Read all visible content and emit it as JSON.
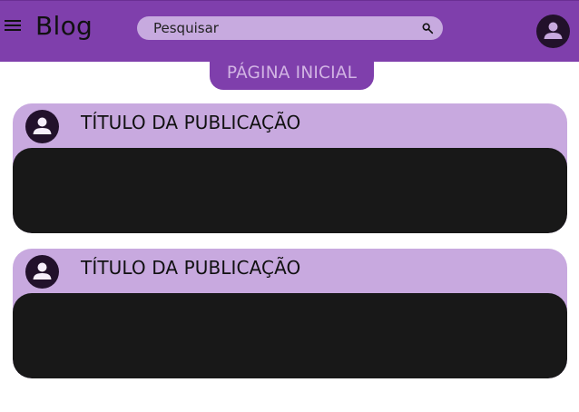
{
  "header": {
    "title": "Blog",
    "search_placeholder": "Pesquisar",
    "menu_icon": "menu-icon",
    "search_icon": "search-icon",
    "avatar_icon": "person-icon",
    "background": "#7f3fac"
  },
  "nav": {
    "home_label": "PÁGINA INICIAL"
  },
  "posts": [
    {
      "title": "TÍTULO DA PUBLICAÇÃO",
      "avatar_icon": "person-icon"
    },
    {
      "title": "TÍTULO DA PUBLICAÇÃO",
      "avatar_icon": "person-icon"
    }
  ],
  "colors": {
    "header_bg": "#7f3fac",
    "search_bg": "#c7aadf",
    "card_bg": "#c8a9df",
    "card_body_bg": "#181818",
    "text": "#111111",
    "pill_text": "#d2b4e4"
  }
}
